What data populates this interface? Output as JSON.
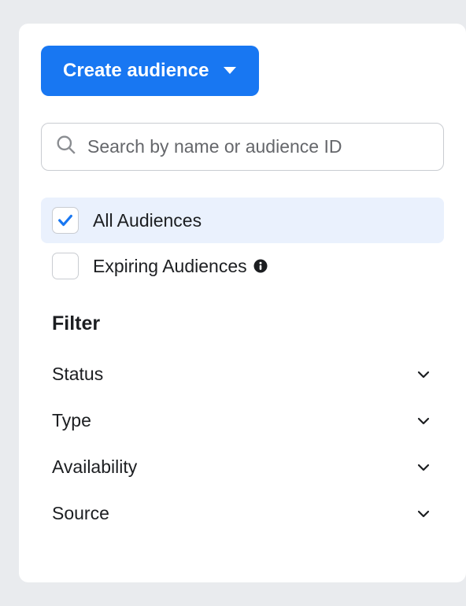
{
  "create_button": {
    "label": "Create audience"
  },
  "search": {
    "placeholder": "Search by name or audience ID"
  },
  "audience_filters": [
    {
      "label": "All Audiences",
      "checked": true,
      "info": false
    },
    {
      "label": "Expiring Audiences",
      "checked": false,
      "info": true
    }
  ],
  "filter_section": {
    "heading": "Filter",
    "items": [
      {
        "label": "Status"
      },
      {
        "label": "Type"
      },
      {
        "label": "Availability"
      },
      {
        "label": "Source"
      }
    ]
  }
}
